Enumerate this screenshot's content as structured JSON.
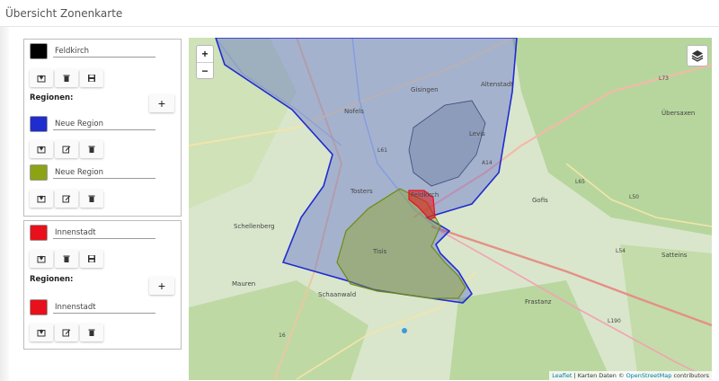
{
  "page": {
    "title": "Übersicht Zonenkarte"
  },
  "colors": {
    "zone_black": "#000000",
    "region_blue": "#1f2cd0",
    "region_olive": "#8ca314",
    "zone_red": "#e8101a"
  },
  "zones": [
    {
      "name": "Feldkirch",
      "color": "#000000",
      "regions_label": "Regionen:",
      "add_label": "+",
      "regions": [
        {
          "name": "Neue Region",
          "color": "#1f2cd0"
        },
        {
          "name": "Neue Region",
          "color": "#8ca314"
        }
      ]
    },
    {
      "name": "Innenstadt",
      "color": "#e8101a",
      "regions_label": "Regionen:",
      "add_label": "+",
      "regions": [
        {
          "name": "Innenstadt",
          "color": "#e8101a"
        }
      ]
    }
  ],
  "icons": {
    "zone_actions": [
      "locate-icon",
      "trash-icon",
      "save-icon"
    ],
    "region_actions": [
      "locate-icon",
      "edit-icon",
      "trash-icon"
    ]
  },
  "map": {
    "zoom_in": "+",
    "zoom_out": "−",
    "attribution": {
      "leaflet": "Leaflet",
      "middle": " | Karten Daten © ",
      "osm": "OpenStreetMap",
      "end": " contributors"
    },
    "labels": [
      "Nofels",
      "Gisingen",
      "Altenstadt",
      "Levis",
      "Tosters",
      "Feldkirch",
      "Tisis",
      "Schellenberg",
      "Mauren",
      "Schaanwald",
      "Gofis",
      "Frastanz",
      "Satteins",
      "Übersaxen",
      "L61",
      "A14",
      "L65",
      "L50",
      "L54",
      "L73",
      "L190",
      "16"
    ]
  }
}
